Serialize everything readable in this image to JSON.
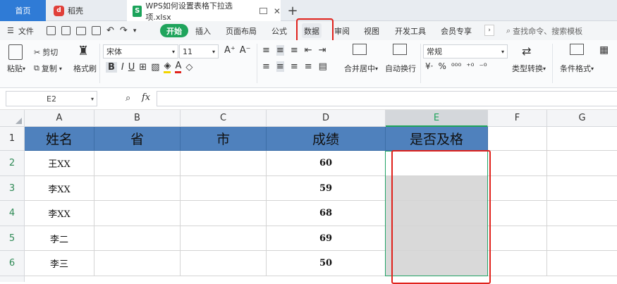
{
  "tabs": {
    "home": "首页",
    "daoke": "稻壳",
    "file": "WPS如何设置表格下拉选项.xlsx"
  },
  "menu": {
    "file": "文件",
    "items": [
      "开始",
      "插入",
      "页面布局",
      "公式",
      "数据",
      "审阅",
      "视图",
      "开发工具",
      "会员专享"
    ],
    "search": "查找命令、搜索模板"
  },
  "ribbon": {
    "paste": "粘贴",
    "cut": "剪切",
    "copy": "复制",
    "format_painter": "格式刷",
    "font_name": "宋体",
    "font_size": "11",
    "merge": "合并居中",
    "wrap": "自动换行",
    "number_format": "常规",
    "type_convert": "类型转换",
    "cond_format": "条件格式"
  },
  "formula_bar": {
    "name_box": "E2",
    "fx": "fx"
  },
  "sheet": {
    "columns": [
      "A",
      "B",
      "C",
      "D",
      "E",
      "F",
      "G"
    ],
    "rows": [
      "1",
      "2",
      "3",
      "4",
      "5",
      "6"
    ],
    "headers": [
      "姓名",
      "省",
      "市",
      "成绩",
      "是否及格"
    ],
    "data": [
      {
        "name": "王XX",
        "score": "60"
      },
      {
        "name": "李XX",
        "score": "59"
      },
      {
        "name": "李XX",
        "score": "68"
      },
      {
        "name": "李二",
        "score": "69"
      },
      {
        "name": "李三",
        "score": "50"
      }
    ]
  },
  "colors": {
    "accent_green": "#1fa45c",
    "tab_blue": "#2f7bd6",
    "header_fill": "#4f81bd",
    "highlight_red": "#e0221c"
  }
}
